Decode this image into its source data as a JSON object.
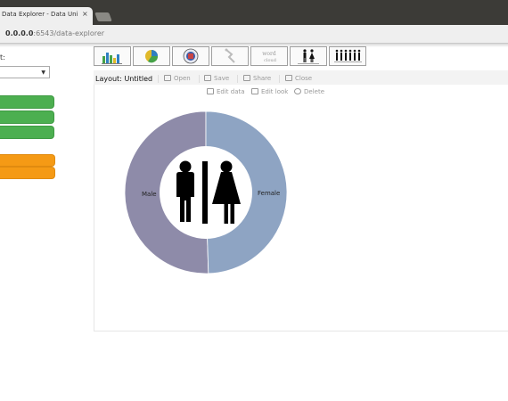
{
  "browser": {
    "tab_title": "Data Explorer - Data Uni",
    "tab_close": "×",
    "url_host": "0.0.0.0",
    "url_path": ":6543/data-explorer"
  },
  "sidebar": {
    "label": "t:",
    "select_value": "",
    "green_buttons": 3,
    "orange_buttons": 2
  },
  "toolbar": {
    "buttons": [
      "bar-chart",
      "pie-chart",
      "map",
      "timeline",
      "word-cloud",
      "person-pair",
      "people-group"
    ],
    "word_cloud_text": "word cloud"
  },
  "layout": {
    "label_prefix": "Layout:",
    "label_name": "Untitled",
    "open": "Open",
    "save": "Save",
    "share": "Share",
    "close": "Close",
    "edit_data": "Edit data",
    "edit_look": "Edit look",
    "delete": "Delete"
  },
  "chart_data": {
    "type": "pie",
    "donut": true,
    "categories": [
      "Male",
      "Female"
    ],
    "values": [
      50.5,
      49.5
    ],
    "colors": [
      "#8e8ba9",
      "#8ea4c3"
    ],
    "title": ""
  }
}
